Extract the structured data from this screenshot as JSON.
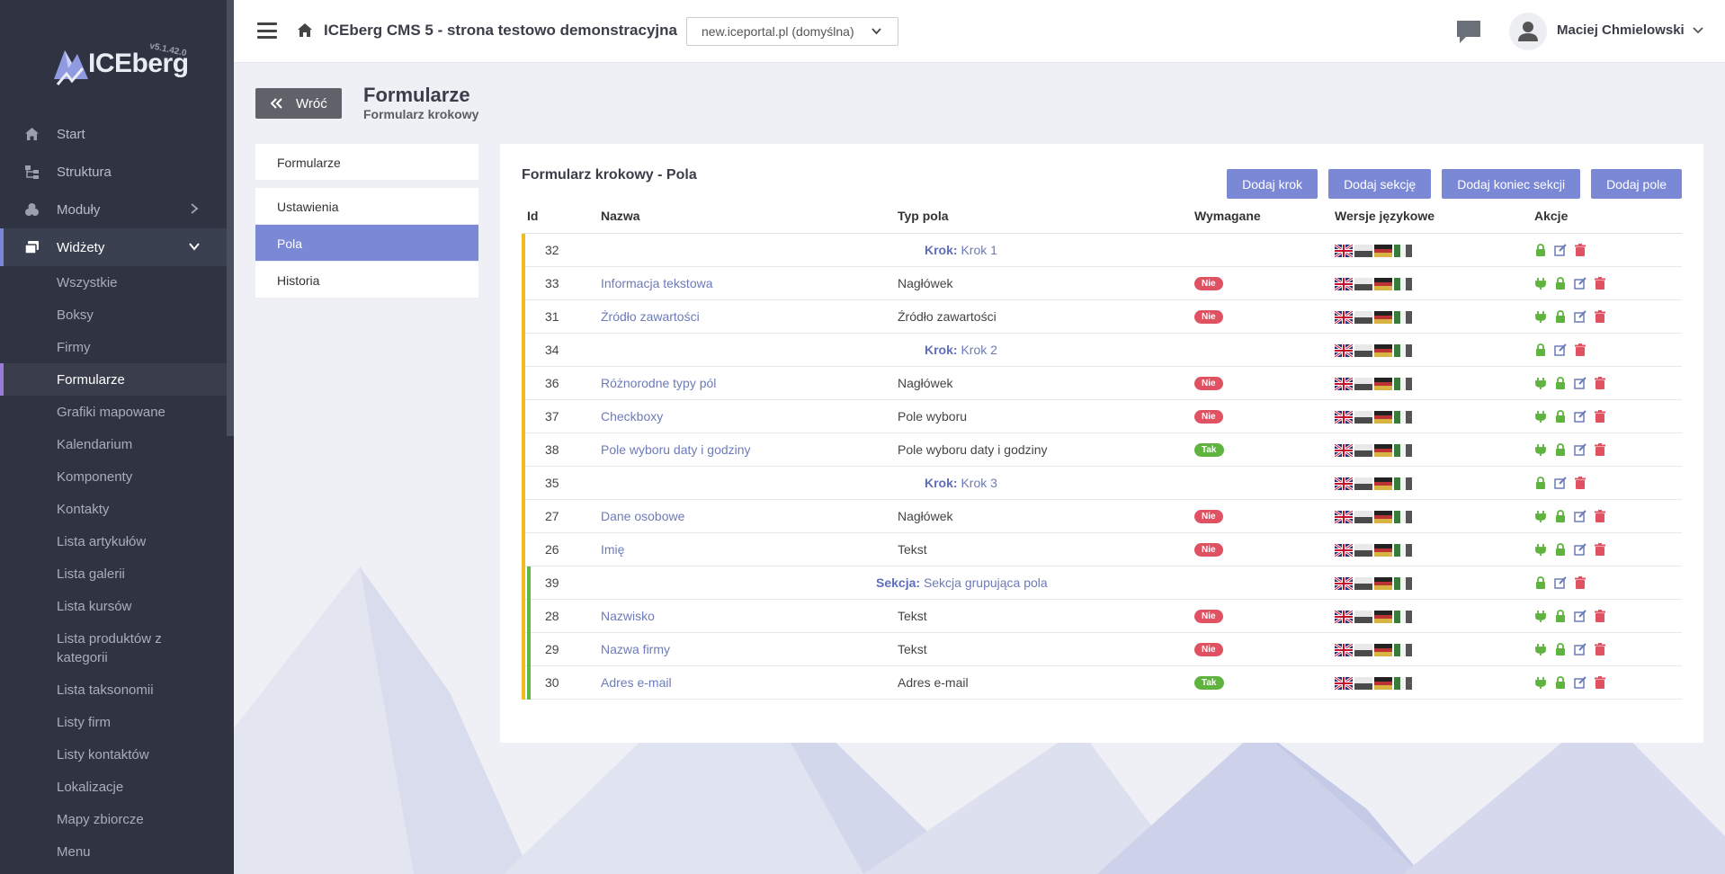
{
  "logo": {
    "name": "ICEberg",
    "version": "v5.1.42.0"
  },
  "sidebar": {
    "items": [
      {
        "label": "Start",
        "icon": "home-icon"
      },
      {
        "label": "Struktura",
        "icon": "tree-icon"
      },
      {
        "label": "Moduły",
        "icon": "modules-icon",
        "has_children": true
      },
      {
        "label": "Widżety",
        "icon": "widgets-icon",
        "has_children": true,
        "expanded": true
      }
    ],
    "subitems": [
      "Wszystkie",
      "Boksy",
      "Firmy",
      "Formularze",
      "Grafiki mapowane",
      "Kalendarium",
      "Komponenty",
      "Kontakty",
      "Lista artykułów",
      "Lista galerii",
      "Lista kursów",
      "Lista produktów z kategorii",
      "Lista taksonomii",
      "Listy firm",
      "Listy kontaktów",
      "Lokalizacje",
      "Mapy zbiorcze",
      "Menu"
    ],
    "active_subitem": "Formularze"
  },
  "header": {
    "site_title": "ICEberg CMS 5 - strona testowo demonstracyjna",
    "site_select": "new.iceportal.pl (domyślna)",
    "user_name": "Maciej Chmielowski"
  },
  "page": {
    "back_label": "Wróć",
    "title": "Formularze",
    "subtitle": "Formularz krokowy"
  },
  "side_menu": {
    "items": [
      "Formularze",
      "Ustawienia",
      "Pola",
      "Historia"
    ],
    "active": "Pola"
  },
  "card": {
    "title": "Formularz krokowy - Pola",
    "buttons": [
      "Dodaj krok",
      "Dodaj sekcję",
      "Dodaj koniec sekcji",
      "Dodaj pole"
    ],
    "columns": [
      "Id",
      "Nazwa",
      "Typ pola",
      "Wymagane",
      "Wersje językowe",
      "Akcje"
    ],
    "rows": [
      {
        "id": "32",
        "kind": "step",
        "prefix": "Krok:",
        "name": "Krok 1",
        "bars": [
          "yellow"
        ]
      },
      {
        "id": "33",
        "kind": "field",
        "name": "Informacja tekstowa",
        "type": "Nagłówek",
        "required": "Nie",
        "bars": [
          "yellow"
        ]
      },
      {
        "id": "31",
        "kind": "field",
        "name": "Źródło zawartości",
        "type": "Źródło zawartości",
        "required": "Nie",
        "bars": [
          "yellow"
        ]
      },
      {
        "id": "34",
        "kind": "step",
        "prefix": "Krok:",
        "name": "Krok 2",
        "bars": [
          "yellow"
        ]
      },
      {
        "id": "36",
        "kind": "field",
        "name": "Różnorodne typy pól",
        "type": "Nagłówek",
        "required": "Nie",
        "bars": [
          "yellow"
        ]
      },
      {
        "id": "37",
        "kind": "field",
        "name": "Checkboxy",
        "type": "Pole wyboru",
        "required": "Nie",
        "bars": [
          "yellow"
        ]
      },
      {
        "id": "38",
        "kind": "field",
        "name": "Pole wyboru daty i godziny",
        "type": "Pole wyboru daty i godziny",
        "required": "Tak",
        "bars": [
          "yellow"
        ]
      },
      {
        "id": "35",
        "kind": "step",
        "prefix": "Krok:",
        "name": "Krok 3",
        "bars": [
          "yellow"
        ]
      },
      {
        "id": "27",
        "kind": "field",
        "name": "Dane osobowe",
        "type": "Nagłówek",
        "required": "Nie",
        "bars": [
          "yellow"
        ]
      },
      {
        "id": "26",
        "kind": "field",
        "name": "Imię",
        "type": "Tekst",
        "required": "Nie",
        "bars": [
          "yellow"
        ]
      },
      {
        "id": "39",
        "kind": "section",
        "prefix": "Sekcja:",
        "name": "Sekcja grupująca pola",
        "bars": [
          "yellow",
          "green"
        ]
      },
      {
        "id": "28",
        "kind": "field",
        "name": "Nazwisko",
        "type": "Tekst",
        "required": "Nie",
        "bars": [
          "yellow",
          "green"
        ]
      },
      {
        "id": "29",
        "kind": "field",
        "name": "Nazwa firmy",
        "type": "Tekst",
        "required": "Nie",
        "bars": [
          "yellow",
          "green"
        ]
      },
      {
        "id": "30",
        "kind": "field",
        "name": "Adres e-mail",
        "type": "Adres e-mail",
        "required": "Tak",
        "bars": [
          "yellow",
          "green"
        ]
      }
    ],
    "languages": [
      "en-flag-icon",
      "pl-flag-icon",
      "de-flag-icon",
      "it-flag-icon"
    ]
  },
  "colors": {
    "accent": "#7a88d6",
    "sidebar_bg": "#2f3342",
    "step_bar": "#f3bb1d",
    "section_bar": "#5fbb3d",
    "badge_no": "#e05262",
    "badge_yes": "#5fb33f",
    "action_green": "#5fb33f",
    "action_blue": "#6d7bb8",
    "action_red": "#e05262"
  }
}
